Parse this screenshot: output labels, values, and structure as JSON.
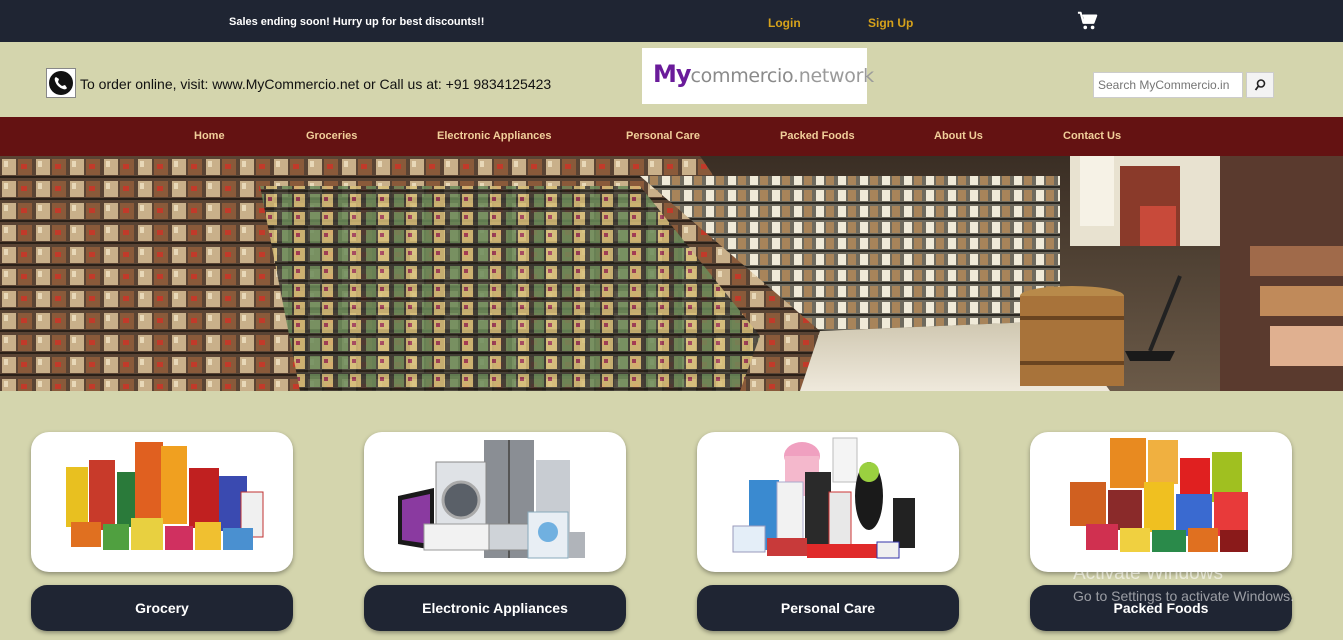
{
  "topbar": {
    "promo": "Sales ending soon! Hurry up for best discounts!!",
    "login": "Login",
    "signup": "Sign Up",
    "cart_icon": "shopping-cart-icon"
  },
  "header": {
    "contact": "To order online, visit: www.MyCommercio.net or Call us at: +91 9834125423",
    "phone_icon": "phone-icon",
    "logo": {
      "my": "My",
      "commercio": "commercio",
      "network": ".network"
    },
    "search": {
      "placeholder": "Search MyCommercio.in",
      "icon": "search-icon"
    }
  },
  "nav": [
    {
      "label": "Home"
    },
    {
      "label": "Groceries"
    },
    {
      "label": "Electronic Appliances"
    },
    {
      "label": "Personal Care"
    },
    {
      "label": "Packed Foods"
    },
    {
      "label": "About Us"
    },
    {
      "label": "Contact Us"
    }
  ],
  "categories": [
    {
      "label": "Grocery"
    },
    {
      "label": "Electronic Appliances"
    },
    {
      "label": "Personal Care"
    },
    {
      "label": "Packed Foods"
    }
  ],
  "watermark": {
    "title": "Activate Windows",
    "subtitle": "Go to Settings to activate Windows."
  },
  "colors": {
    "topbar": "#1f2533",
    "background": "#d4d5ad",
    "nav": "#641212",
    "nav_text": "#f1cf9a",
    "accent": "#d6a21b",
    "logo_purple": "#6a1b9a"
  }
}
